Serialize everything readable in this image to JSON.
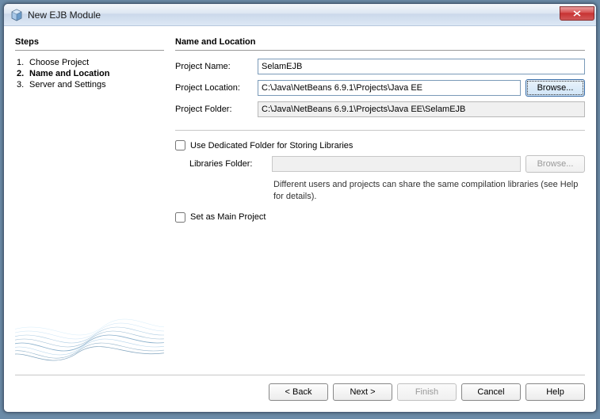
{
  "window": {
    "title": "New EJB Module"
  },
  "steps": {
    "heading": "Steps",
    "items": [
      {
        "num": "1.",
        "label": "Choose Project",
        "current": false
      },
      {
        "num": "2.",
        "label": "Name and Location",
        "current": true
      },
      {
        "num": "3.",
        "label": "Server and Settings",
        "current": false
      }
    ]
  },
  "main": {
    "heading": "Name and Location",
    "project_name_label": "Project Name:",
    "project_name_value": "SelamEJB",
    "project_location_label": "Project Location:",
    "project_location_value": "C:\\Java\\NetBeans 6.9.1\\Projects\\Java EE",
    "browse1_label": "Browse...",
    "project_folder_label": "Project Folder:",
    "project_folder_value": "C:\\Java\\NetBeans 6.9.1\\Projects\\Java EE\\SelamEJB",
    "dedicated_label": "Use Dedicated Folder for Storing Libraries",
    "libraries_label": "Libraries Folder:",
    "libraries_value": "",
    "browse2_label": "Browse...",
    "hint": "Different users and projects can share the same compilation libraries (see Help for details).",
    "main_project_label": "Set as Main Project"
  },
  "buttons": {
    "back": "< Back",
    "next": "Next >",
    "finish": "Finish",
    "cancel": "Cancel",
    "help": "Help"
  }
}
